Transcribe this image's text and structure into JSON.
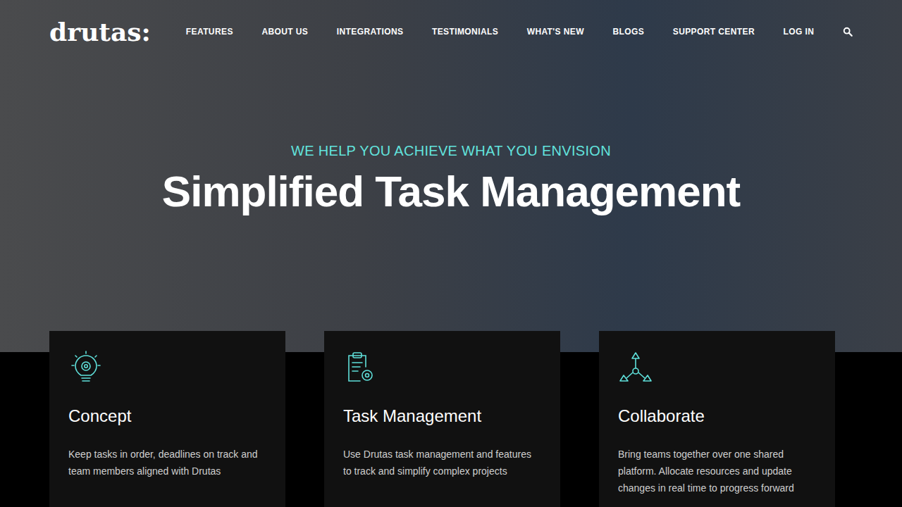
{
  "header": {
    "logo": "drutas:",
    "nav": [
      "FEATURES",
      "ABOUT US",
      "INTEGRATIONS",
      "TESTIMONIALS",
      "WHAT'S NEW",
      "BLOGS",
      "SUPPORT CENTER",
      "LOG IN"
    ]
  },
  "hero": {
    "eyebrow": "WE HELP YOU ACHIEVE WHAT YOU ENVISION",
    "title": "Simplified Task Management"
  },
  "cards": [
    {
      "kind": "bulb",
      "title": "Concept",
      "text": "Keep tasks in order, deadlines on track and team members aligned with Drutas"
    },
    {
      "kind": "clipboard",
      "title": "Task Management",
      "text": "Use Drutas task management and features to track and simplify complex projects"
    },
    {
      "kind": "network",
      "title": "Collaborate",
      "text": "Bring teams together over one shared platform. Allocate resources and update changes in real time to progress forward"
    }
  ]
}
